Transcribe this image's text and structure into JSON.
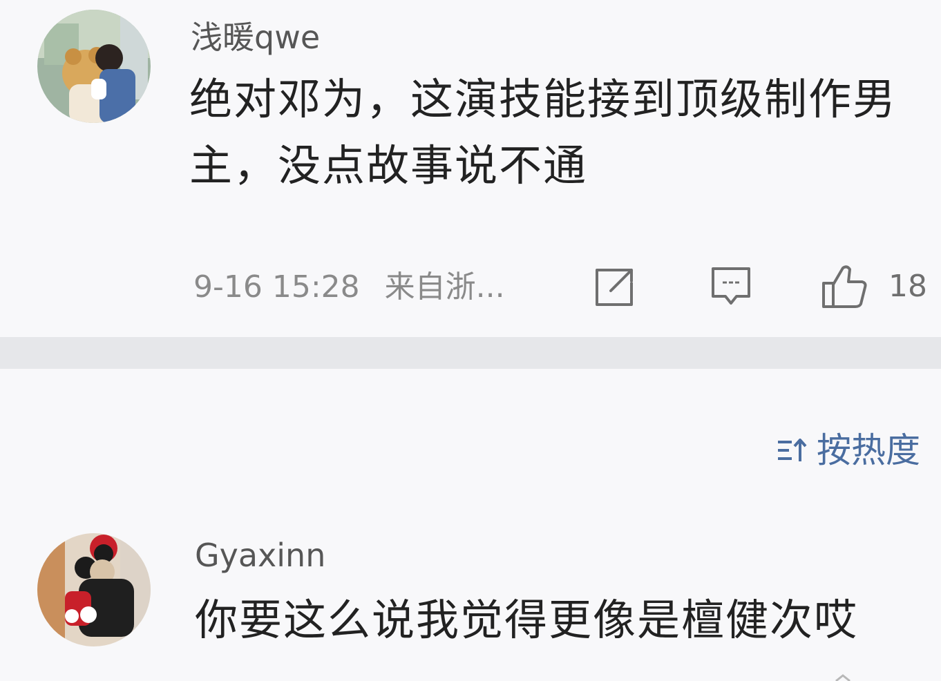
{
  "post": {
    "username": "浅暖qwe",
    "content_line1": "绝对邓为，这演技能接到顶级制作男",
    "content_line2": "主，没点故事说不通",
    "time": "9-16 15:28",
    "source": "来自浙...",
    "like_count": "18",
    "icons": {
      "repost": "repost-icon",
      "comment": "comment-icon",
      "like": "thumbs-up-icon"
    }
  },
  "comments": {
    "sort_label": "按热度",
    "sort_icon": "sort-icon",
    "items": [
      {
        "username": "Gyaxinn",
        "content": "你要这么说我觉得更像是檀健次哎"
      }
    ]
  },
  "colors": {
    "background": "#f8f8fa",
    "divider": "#e6e7ea",
    "accent": "#4a6da0",
    "text_primary": "#222222",
    "text_secondary": "#8a8a8a"
  }
}
